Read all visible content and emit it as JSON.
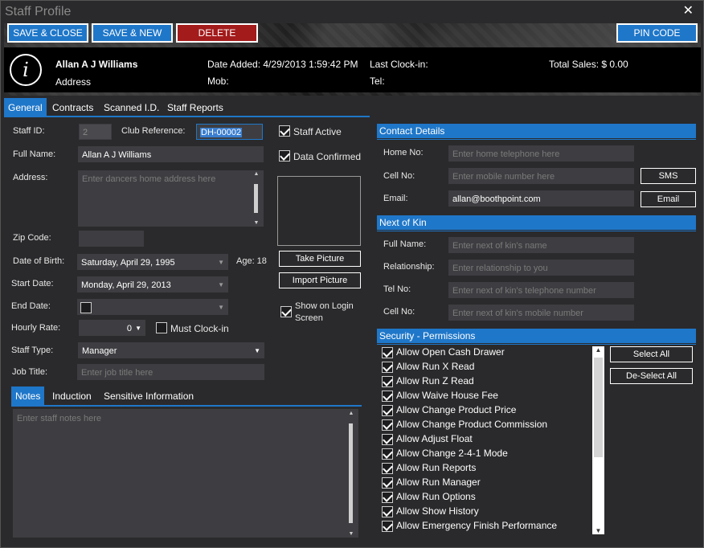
{
  "window": {
    "title": "Staff Profile",
    "close_glyph": "✕"
  },
  "toolbar": {
    "save_close": "SAVE & CLOSE",
    "save_new": "SAVE & NEW",
    "delete": "DELETE",
    "pin_code": "PIN CODE"
  },
  "colors": {
    "accent": "#1f77c9",
    "danger": "#a31b1b",
    "field": "#3e3e42",
    "background": "#2a2a2c"
  },
  "info": {
    "icon": "info-icon",
    "name": "Allan A J Williams",
    "address_label": "Address",
    "date_added": "Date Added: 4/29/2013 1:59:42 PM",
    "mob": "Mob:",
    "last_clock_in": "Last Clock-in:",
    "tel": "Tel:",
    "total_sales": "Total Sales: $ 0.00"
  },
  "tabs": [
    "General",
    "Contracts",
    "Scanned I.D.",
    "Staff Reports"
  ],
  "general": {
    "staff_id_label": "Staff ID:",
    "staff_id": "2",
    "club_ref_label": "Club Reference:",
    "club_ref": "DH-00002",
    "full_name_label": "Full Name:",
    "full_name": "Allan A J Williams",
    "address_label": "Address:",
    "address_placeholder": "Enter dancers home address here",
    "zip_label": "Zip Code:",
    "dob_label": "Date of Birth:",
    "dob": "Saturday, April 29, 1995",
    "age": "Age: 18",
    "start_label": "Start Date:",
    "start": "Monday, April 29, 2013",
    "end_label": "End Date:",
    "hourly_label": "Hourly Rate:",
    "hourly": "0",
    "must_clock": "Must Clock-in",
    "staff_type_label": "Staff Type:",
    "staff_type": "Manager",
    "job_title_label": "Job Title:",
    "job_title_placeholder": "Enter job title here",
    "staff_active": "Staff Active",
    "data_confirmed": "Data Confirmed",
    "take_picture": "Take Picture",
    "import_picture": "Import Picture",
    "show_login_1": "Show on Login",
    "show_login_2": "Screen"
  },
  "notes_tabs": [
    "Notes",
    "Induction",
    "Sensitive Information"
  ],
  "notes_placeholder": "Enter staff notes here",
  "contact": {
    "header": "Contact Details",
    "home_label": "Home No:",
    "home_placeholder": "Enter home telephone here",
    "cell_label": "Cell No:",
    "cell_placeholder": "Enter mobile number here",
    "sms": "SMS",
    "email_label": "Email:",
    "email": "allan@boothpoint.com",
    "email_btn": "Email"
  },
  "kin": {
    "header": "Next of Kin",
    "name_label": "Full Name:",
    "name_placeholder": "Enter next of kin's name",
    "rel_label": "Relationship:",
    "rel_placeholder": "Enter relationship to you",
    "tel_label": "Tel No:",
    "tel_placeholder": "Enter next of kin's telephone number",
    "cell_label": "Cell No:",
    "cell_placeholder": "Enter next of kin's mobile number"
  },
  "security": {
    "header": "Security - Permissions",
    "select_all": "Select All",
    "deselect_all": "De-Select All",
    "permissions": [
      "Allow Open Cash Drawer",
      "Allow Run X Read",
      "Allow Run Z Read",
      "Allow Waive House Fee",
      "Allow Change Product Price",
      "Allow Change Product Commission",
      "Allow Adjust Float",
      "Allow Change 2-4-1 Mode",
      "Allow Run Reports",
      "Allow Run Manager",
      "Allow Run Options",
      "Allow Show History",
      "Allow Emergency Finish Performance"
    ]
  }
}
